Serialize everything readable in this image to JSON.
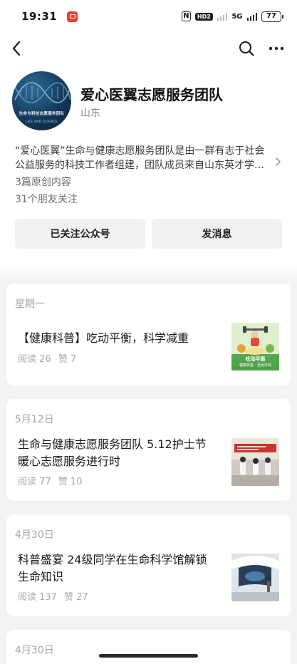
{
  "status_bar": {
    "time": "19:31",
    "nfc": "N",
    "hd": "HD2",
    "network": "5G",
    "battery": "77"
  },
  "nav": {
    "back_icon": "chevron-left-icon",
    "search_icon": "search-icon",
    "more_icon": "more-horizontal-icon"
  },
  "profile": {
    "avatar_text": "生命与科技志愿服务团队",
    "avatar_subtext": "LIFE AND SCIENCE",
    "name": "爱心医翼志愿服务团队",
    "region": "山东",
    "intro": "“爱心医翼”生命与健康志愿服务团队是由一群有志于社会公益服务的科技工作者组建，团队成员来自山东英才学…",
    "original_count": "3篇原创内容",
    "friends_following": "31个朋友关注"
  },
  "actions": {
    "followed_label": "已关注公众号",
    "message_label": "发消息"
  },
  "articles": [
    {
      "date": "星期一",
      "title": "【健康科普】吃动平衡，科学减重",
      "reads": "阅读 26",
      "likes": "赞 7",
      "thumb_caption_1": "吃动平衡",
      "thumb_caption_2": "健康体重 · 全民行动"
    },
    {
      "date": "5月12日",
      "title": "生命与健康志愿服务团队 5.12护士节暖心志愿服务进行时",
      "reads": "阅读 77",
      "likes": "赞 10"
    },
    {
      "date": "4月30日",
      "title": "科普盛宴 24级同学在生命科学馆解锁生命知识",
      "reads": "阅读 137",
      "likes": "赞 27"
    },
    {
      "date": "4月30日"
    }
  ]
}
